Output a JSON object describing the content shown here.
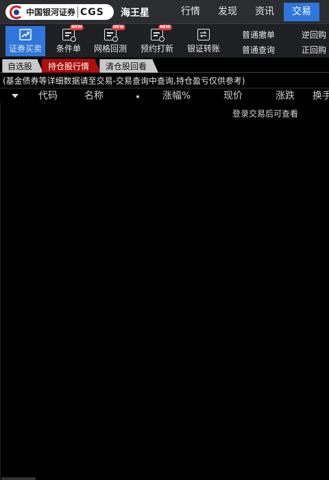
{
  "header": {
    "logo_cn": "中国银河证券",
    "logo_en": "CGS",
    "app_name": "海王星",
    "nav": [
      {
        "label": "行情",
        "active": false
      },
      {
        "label": "发现",
        "active": false
      },
      {
        "label": "资讯",
        "active": false
      },
      {
        "label": "交易",
        "active": true
      }
    ]
  },
  "toolbar": {
    "tools": [
      {
        "label": "证券买卖",
        "icon": "trend-up-icon",
        "badge": "",
        "active": true
      },
      {
        "label": "条件单",
        "icon": "document-check-icon",
        "badge": "NEW",
        "active": false
      },
      {
        "label": "网格回测",
        "icon": "document-check-icon",
        "badge": "NEW",
        "active": false
      },
      {
        "label": "预约打新",
        "icon": "document-check-icon",
        "badge": "NEW",
        "active": false
      },
      {
        "label": "银证转账",
        "icon": "transfer-icon",
        "badge": "",
        "active": false
      }
    ],
    "links": {
      "cancel_order": "普通撤单",
      "query": "普通查询",
      "reverse_repo": "逆回购",
      "forward_repo": "正回购"
    }
  },
  "subtabs": [
    {
      "label": "自选股",
      "active": false
    },
    {
      "label": "持仓股行情",
      "active": true
    },
    {
      "label": "清仓股回看",
      "active": false
    }
  ],
  "notice": "(基金债券等详细数据请至交易-交易查询中查询,持仓盈亏仅供参考)",
  "table": {
    "columns": [
      "代码",
      "名称",
      "涨幅%",
      "现价",
      "涨跌",
      "换手"
    ]
  },
  "empty_message": "登录交易后可查看",
  "colors": {
    "accent": "#2f76dc",
    "active_tab": "#b00d0d",
    "badge": "#e23b3b"
  }
}
